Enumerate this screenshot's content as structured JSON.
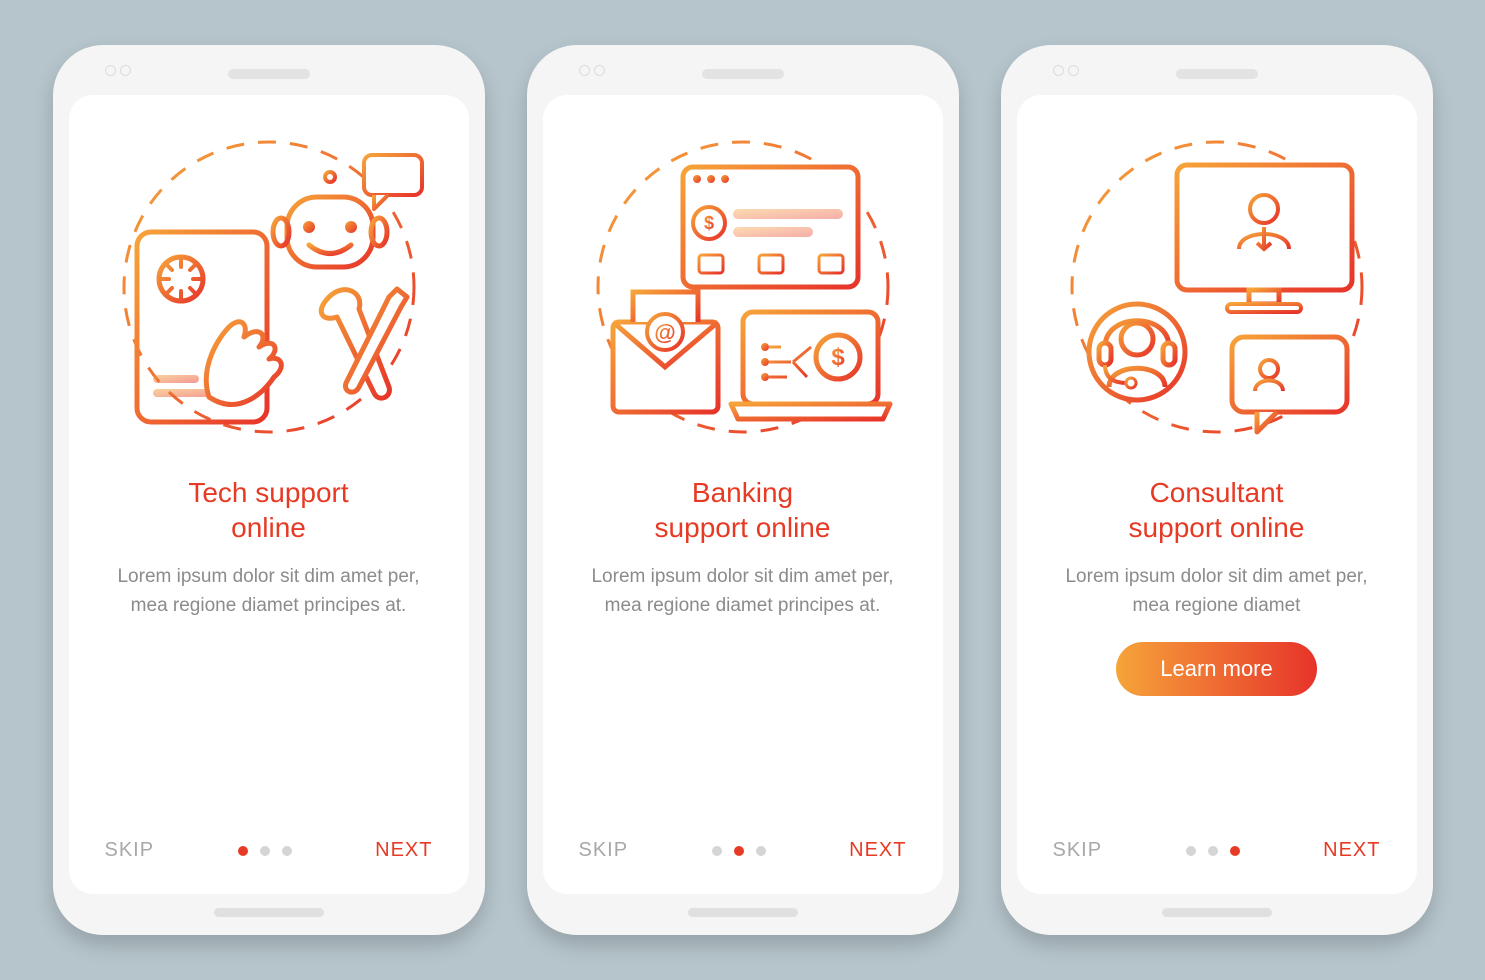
{
  "screens": [
    {
      "title": "Tech support\nonline",
      "desc": "Lorem ipsum dolor sit dim amet per, mea regione diamet principes at.",
      "skip": "SKIP",
      "next": "NEXT",
      "activeDot": 0,
      "hasCta": false
    },
    {
      "title": "Banking\nsupport online",
      "desc": "Lorem ipsum dolor sit dim amet per, mea regione diamet principes at.",
      "skip": "SKIP",
      "next": "NEXT",
      "activeDot": 1,
      "hasCta": false
    },
    {
      "title": "Consultant\nsupport online",
      "desc": "Lorem ipsum dolor sit dim amet per, mea regione diamet",
      "skip": "SKIP",
      "next": "NEXT",
      "activeDot": 2,
      "hasCta": true,
      "cta": "Learn more"
    }
  ]
}
